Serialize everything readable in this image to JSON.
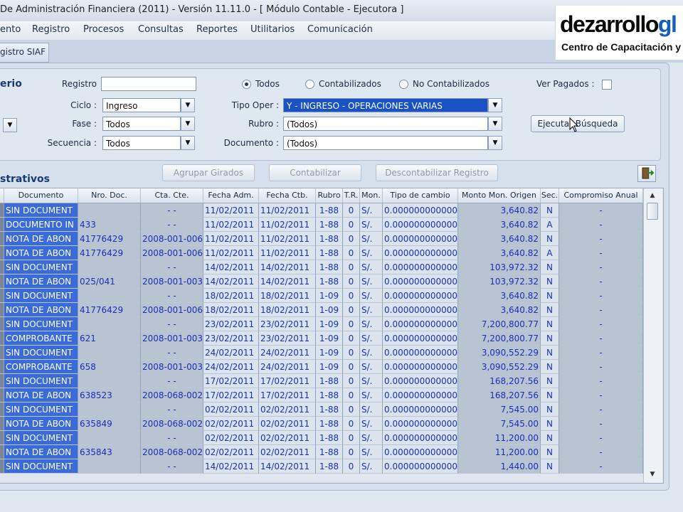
{
  "window": {
    "title": "De Administración Financiera (2011) - Versión 11.11.0 - [ Módulo Contable - Ejecutora ]"
  },
  "menu": [
    "ento",
    "Registro",
    "Procesos",
    "Consultas",
    "Reportes",
    "Utilitarios",
    "Comunicación"
  ],
  "tab": {
    "label": "gistro SIAF"
  },
  "logo": {
    "line1_main": "dezarrollo",
    "line1_accent": "gl",
    "line2": "Centro de Capacitación y"
  },
  "filters": {
    "section_title": "erio",
    "registro_label": "Registro",
    "registro_value": "",
    "ciclo_label": "Ciclo :",
    "ciclo_value": "Ingreso",
    "fase_label": "Fase :",
    "fase_value": "Todos",
    "secuencia_label": "Secuencia :",
    "secuencia_value": "Todos",
    "radio_todos": "Todos",
    "radio_contabilizados": "Contabilizados",
    "radio_no_contabilizados": "No Contabilizados",
    "tipo_oper_label": "Tipo Oper :",
    "tipo_oper_value": "Y - INGRESO - OPERACIONES VARIAS",
    "rubro_label": "Rubro :",
    "rubro_value": "(Todos)",
    "documento_label": "Documento :",
    "documento_value": "(Todos)",
    "ver_pagados_label": "Ver Pagados :",
    "search_button": "Ejecutar Búsqueda"
  },
  "actions": {
    "section_title": "strativos",
    "agrupar": "Agrupar Girados",
    "contabilizar": "Contabilizar",
    "descontabilizar": "Descontabilizar Registro"
  },
  "grid": {
    "headers": [
      "Documento",
      "Nro. Doc.",
      "Cta. Cte.",
      "Fecha Adm.",
      "Fecha Ctb.",
      "Rubro",
      "T.R.",
      "Mon.",
      "Tipo de cambio",
      "Monto Mon. Origen",
      "Sec.",
      "Compromiso Anual"
    ],
    "rows": [
      [
        "SIN DOCUMENT",
        "",
        "-  -",
        "11/02/2011",
        "11/02/2011",
        "1-88",
        "0",
        "S/.",
        "0.000000000000",
        "3,640.82",
        "N",
        "-"
      ],
      [
        "DOCUMENTO IN",
        "433",
        "-  -",
        "11/02/2011",
        "11/02/2011",
        "1-88",
        "0",
        "S/.",
        "0.000000000000",
        "3,640.82",
        "A",
        "-"
      ],
      [
        "NOTA DE ABON",
        "41776429",
        "2008-001-006",
        "11/02/2011",
        "11/02/2011",
        "1-88",
        "0",
        "S/.",
        "0.000000000000",
        "3,640.82",
        "N",
        "-"
      ],
      [
        "NOTA DE ABON",
        "41776429",
        "2008-001-006",
        "11/02/2011",
        "11/02/2011",
        "1-88",
        "0",
        "S/.",
        "0.000000000000",
        "3,640.82",
        "A",
        "-"
      ],
      [
        "SIN DOCUMENT",
        "",
        "-  -",
        "14/02/2011",
        "14/02/2011",
        "1-88",
        "0",
        "S/.",
        "0.000000000000",
        "103,972.32",
        "N",
        "-"
      ],
      [
        "NOTA DE ABON",
        "025/041",
        "2008-001-003",
        "14/02/2011",
        "14/02/2011",
        "1-88",
        "0",
        "S/.",
        "0.000000000000",
        "103,972.32",
        "N",
        "-"
      ],
      [
        "SIN DOCUMENT",
        "",
        "-  -",
        "18/02/2011",
        "18/02/2011",
        "1-09",
        "0",
        "S/.",
        "0.000000000000",
        "3,640.82",
        "N",
        "-"
      ],
      [
        "NOTA DE ABON",
        "41776429",
        "2008-001-006",
        "18/02/2011",
        "18/02/2011",
        "1-09",
        "0",
        "S/.",
        "0.000000000000",
        "3,640.82",
        "N",
        "-"
      ],
      [
        "SIN DOCUMENT",
        "",
        "-  -",
        "23/02/2011",
        "23/02/2011",
        "1-09",
        "0",
        "S/.",
        "0.000000000000",
        "7,200,800.77",
        "N",
        "-"
      ],
      [
        "COMPROBANTE",
        "621",
        "2008-001-003",
        "23/02/2011",
        "23/02/2011",
        "1-09",
        "0",
        "S/.",
        "0.000000000000",
        "7,200,800.77",
        "N",
        "-"
      ],
      [
        "SIN DOCUMENT",
        "",
        "-  -",
        "24/02/2011",
        "24/02/2011",
        "1-09",
        "0",
        "S/.",
        "0.000000000000",
        "3,090,552.29",
        "N",
        "-"
      ],
      [
        "COMPROBANTE",
        "658",
        "2008-001-003",
        "24/02/2011",
        "24/02/2011",
        "1-09",
        "0",
        "S/.",
        "0.000000000000",
        "3,090,552.29",
        "N",
        "-"
      ],
      [
        "SIN DOCUMENT",
        "",
        "-  -",
        "17/02/2011",
        "17/02/2011",
        "1-88",
        "0",
        "S/.",
        "0.000000000000",
        "168,207.56",
        "N",
        "-"
      ],
      [
        "NOTA DE ABON",
        "638523",
        "2008-068-002",
        "17/02/2011",
        "17/02/2011",
        "1-88",
        "0",
        "S/.",
        "0.000000000000",
        "168,207.56",
        "N",
        "-"
      ],
      [
        "SIN DOCUMENT",
        "",
        "-  -",
        "02/02/2011",
        "02/02/2011",
        "1-88",
        "0",
        "S/.",
        "0.000000000000",
        "7,545.00",
        "N",
        "-"
      ],
      [
        "NOTA DE ABON",
        "635849",
        "2008-068-002",
        "02/02/2011",
        "02/02/2011",
        "1-88",
        "0",
        "S/.",
        "0.000000000000",
        "7,545.00",
        "N",
        "-"
      ],
      [
        "SIN DOCUMENT",
        "",
        "-  -",
        "02/02/2011",
        "02/02/2011",
        "1-88",
        "0",
        "S/.",
        "0.000000000000",
        "11,200.00",
        "N",
        "-"
      ],
      [
        "NOTA DE ABON",
        "635843",
        "2008-068-002",
        "02/02/2011",
        "02/02/2011",
        "1-88",
        "0",
        "S/.",
        "0.000000000000",
        "11,200.00",
        "N",
        "-"
      ],
      [
        "SIN DOCUMENT",
        "",
        "-  -",
        "14/02/2011",
        "14/02/2011",
        "1-88",
        "0",
        "S/.",
        "0.000000000000",
        "1,440.00",
        "N",
        "-"
      ]
    ]
  }
}
